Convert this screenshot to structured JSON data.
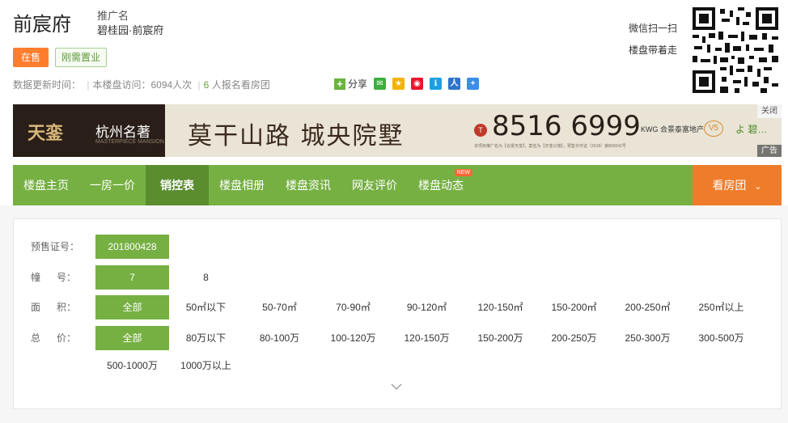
{
  "header": {
    "title": "前宸府",
    "promo_label": "推广名",
    "promo_name": "碧桂园·前宸府",
    "badge_status": "在售",
    "badge_tag": "刚需置业",
    "updated_label": "数据更新时间：",
    "visits_text": "本楼盘访问：6094人次",
    "signup_count": "6",
    "signup_text": "人报名看房团",
    "share_label": "分享",
    "wechat_scan": "微信扫一扫",
    "wechat_take": "楼盘带着走"
  },
  "banner": {
    "brand_main": "天銮",
    "brand_sub": "杭州名著",
    "brand_en": "MASTERPIECE MANSION",
    "headline": "莫干山路  城央院墅",
    "tel_mark": "T",
    "phone": "8516 6999",
    "fine_print": "本项目推广名为【合景天銮】，案名为【天銮公馆】，预售许可证（2018）第800041号",
    "developer": "KWG 合景泰富地产",
    "badge_v5": "V5",
    "badge_leaf": "よ 碧…",
    "close_label": "关闭",
    "ad_label": "广告"
  },
  "nav": {
    "items": [
      {
        "label": "楼盘主页",
        "active": false
      },
      {
        "label": "一房一价",
        "active": false
      },
      {
        "label": "销控表",
        "active": true
      },
      {
        "label": "楼盘相册",
        "active": false
      },
      {
        "label": "楼盘资讯",
        "active": false
      },
      {
        "label": "网友评价",
        "active": false
      },
      {
        "label": "楼盘动态",
        "active": false
      }
    ],
    "new_badge": "NEW",
    "right_label": "看房团"
  },
  "filters": {
    "permit": {
      "label": "预售证号：",
      "options": [
        "201800428"
      ]
    },
    "building": {
      "label": "幢      号：",
      "options": [
        "7",
        "8"
      ]
    },
    "area": {
      "label": "面      积：",
      "options": [
        "全部",
        "50㎡以下",
        "50-70㎡",
        "70-90㎡",
        "90-120㎡",
        "120-150㎡",
        "150-200㎡",
        "200-250㎡",
        "250㎡以上"
      ]
    },
    "price": {
      "label": "总      价：",
      "options": [
        "全部",
        "80万以下",
        "80-100万",
        "100-120万",
        "120-150万",
        "150-200万",
        "200-250万",
        "250-300万",
        "300-500万",
        "500-1000万",
        "1000万以上"
      ]
    }
  },
  "colors": {
    "green": "#76b043",
    "green_dark": "#5b8d2f",
    "orange": "#ef7c2a",
    "badge_orange": "#ff7e2e"
  }
}
